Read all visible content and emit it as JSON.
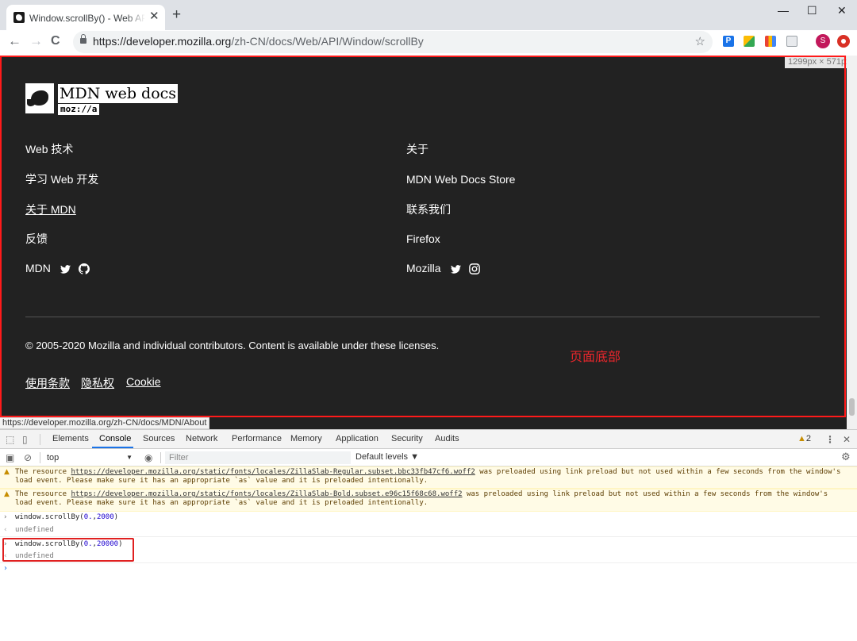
{
  "browser": {
    "tab_title": "Window.scrollBy() - Web API 接口",
    "tab_close": "✕",
    "new_tab": "+",
    "minimize": "—",
    "maximize": "☐",
    "close": "✕",
    "back": "←",
    "forward": "→",
    "reload": "C",
    "url_host": "https://developer.mozilla.org",
    "url_path": "/zh-CN/docs/Web/API/Window/scrollBy",
    "bookmark_star": "☆",
    "profile_initial": "S"
  },
  "page": {
    "size_badge": "1299px × 571px",
    "logo_text": "MDN web docs",
    "logo_sub": "moz://a",
    "footer_links_left": [
      "Web 技术",
      "学习 Web 开发",
      "关于 MDN",
      "反馈"
    ],
    "footer_links_right": [
      "关于",
      "MDN Web Docs Store",
      "联系我们",
      "Firefox"
    ],
    "social_left": "MDN",
    "social_right": "Mozilla",
    "copyright": "© 2005-2020 Mozilla and individual contributors. Content is available under these licenses.",
    "legal_links": [
      "使用条款",
      "隐私权",
      "Cookie"
    ],
    "annotation": "页面底部",
    "status_url": "https://developer.mozilla.org/zh-CN/docs/MDN/About"
  },
  "devtools": {
    "tabs": [
      "Elements",
      "Console",
      "Sources",
      "Network",
      "Performance",
      "Memory",
      "Application",
      "Security",
      "Audits"
    ],
    "active_tab": "Console",
    "warning_count": "2",
    "context": "top",
    "filter_placeholder": "Filter",
    "levels": "Default levels ▼",
    "warnings": [
      {
        "prefix": "The resource ",
        "link": "https://developer.mozilla.org/static/fonts/locales/ZillaSlab-Regular.subset.bbc33fb47cf6.woff2",
        "suffix": " was preloaded using link preload but not used within a few seconds from the window's load event. Please make sure it has an appropriate `as` value and it is preloaded intentionally."
      },
      {
        "prefix": "The resource ",
        "link": "https://developer.mozilla.org/static/fonts/locales/ZillaSlab-Bold.subset.e96c15f68c68.woff2",
        "suffix": " was preloaded using link preload but not used within a few seconds from the window's load event. Please make sure it has an appropriate `as` value and it is preloaded intentionally."
      }
    ],
    "commands": [
      {
        "call": "window.scrollBy(",
        "arg1": "0.",
        "sep": ",",
        "arg2": "2000",
        "close": ")",
        "result": "undefined"
      },
      {
        "call": "window.scrollBy(",
        "arg1": "0.",
        "sep": ",",
        "arg2": "20000",
        "close": ")",
        "result": "undefined"
      }
    ]
  },
  "colors": {
    "footer_bg": "#222222",
    "highlight_red": "#ff1a1a",
    "annotation_red": "#e8262b",
    "devtools_accent": "#1a73e8"
  }
}
